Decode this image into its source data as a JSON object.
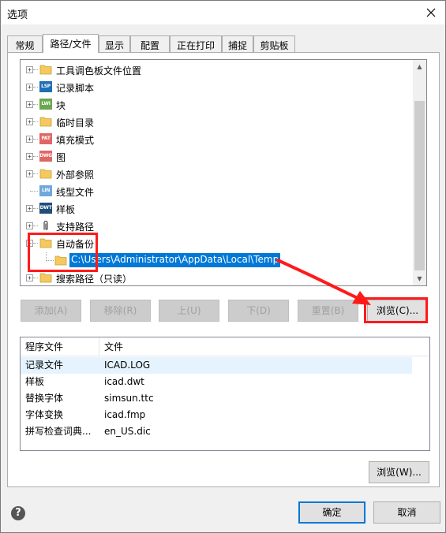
{
  "window": {
    "title": "选项"
  },
  "tabs": [
    {
      "label": "常规"
    },
    {
      "label": "路径/文件"
    },
    {
      "label": "显示"
    },
    {
      "label": "配置"
    },
    {
      "label": "正在打印"
    },
    {
      "label": "捕捉"
    },
    {
      "label": "剪贴板"
    }
  ],
  "tree": {
    "items": [
      {
        "label": "工具调色板文件位置",
        "icon": "folder-icon",
        "badge": ""
      },
      {
        "label": "记录脚本",
        "icon": "lsp-file-icon",
        "badge": "LSP"
      },
      {
        "label": "块",
        "icon": "lwi-file-icon",
        "badge": "LWI"
      },
      {
        "label": "临时目录",
        "icon": "folder-icon",
        "badge": ""
      },
      {
        "label": "填充模式",
        "icon": "pat-file-icon",
        "badge": "PAT"
      },
      {
        "label": "图",
        "icon": "dwg-file-icon",
        "badge": "DWG"
      },
      {
        "label": "外部参照",
        "icon": "folder-icon",
        "badge": ""
      },
      {
        "label": "线型文件",
        "icon": "lin-file-icon",
        "badge": "LIN"
      },
      {
        "label": "样板",
        "icon": "dwt-file-icon",
        "badge": "DWT"
      },
      {
        "label": "支持路径",
        "icon": "paperclip-icon",
        "badge": ""
      },
      {
        "label": "自动备份",
        "icon": "folder-icon",
        "badge": ""
      },
      {
        "label": "搜索路径（只读）",
        "icon": "folder-icon",
        "badge": ""
      }
    ],
    "child_path": "C:\\Users\\Administrator\\AppData\\Local\\Temp"
  },
  "buttons": {
    "add": "添加(A)",
    "remove": "移除(R)",
    "up": "上(U)",
    "down": "下(D)",
    "reset": "重置(B)",
    "browse_c": "浏览(C)...",
    "browse_w": "浏览(W)...",
    "ok": "确定",
    "cancel": "取消"
  },
  "file_list": {
    "headers": [
      "程序文件",
      "文件"
    ],
    "rows": [
      [
        "记录文件",
        "ICAD.LOG"
      ],
      [
        "样板",
        "icad.dwt"
      ],
      [
        "替换字体",
        "simsun.ttc"
      ],
      [
        "字体变换",
        "icad.fmp"
      ],
      [
        "拼写检查词典...",
        "en_US.dic"
      ]
    ]
  },
  "colors": {
    "accent": "#0078d7",
    "annotation_red": "#ff1a1a",
    "lsp_badge": "#1f6fb5",
    "lwi_badge": "#6aa84f",
    "pat_badge": "#e06666",
    "dwg_badge": "#e06666",
    "lin_badge": "#6fa8dc",
    "dwt_badge": "#1f4e79"
  }
}
